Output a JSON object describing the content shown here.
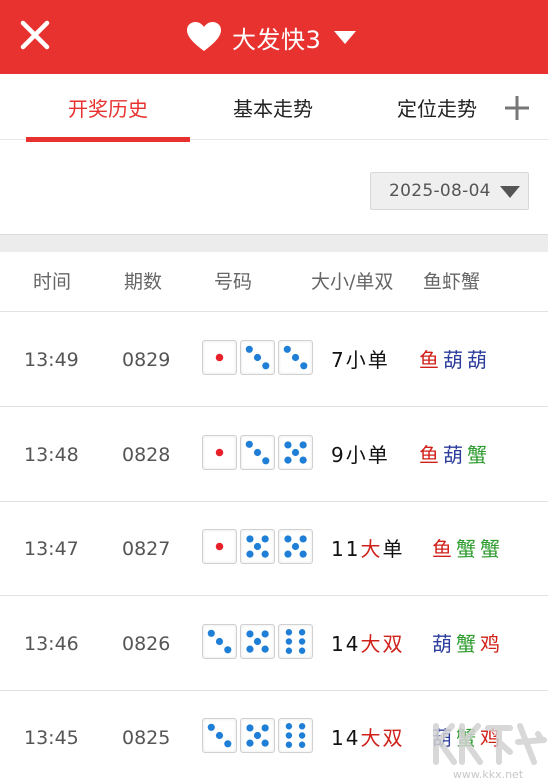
{
  "header": {
    "title": "大发快3",
    "close_icon": "close-icon",
    "favorite_icon": "heart-icon",
    "dropdown_icon": "caret-down-icon",
    "bar_color": "#e8322f"
  },
  "tabs": [
    {
      "label": "开奖历史",
      "active": true
    },
    {
      "label": "基本走势",
      "active": false
    },
    {
      "label": "定位走势",
      "active": false
    }
  ],
  "add_tab_icon": "plus-icon",
  "date_filter": {
    "value": "2025-08-04",
    "icon": "caret-down-icon"
  },
  "table": {
    "columns": [
      "时间",
      "期数",
      "号码",
      "大小/单双",
      "鱼虾蟹"
    ],
    "rows": [
      {
        "time": "13:49",
        "period": "0829",
        "dice": [
          1,
          3,
          3
        ],
        "sum": "7",
        "size": "小",
        "parity": "单",
        "animals": [
          "鱼",
          "葫",
          "葫"
        ]
      },
      {
        "time": "13:48",
        "period": "0828",
        "dice": [
          1,
          3,
          5
        ],
        "sum": "9",
        "size": "小",
        "parity": "单",
        "animals": [
          "鱼",
          "葫",
          "蟹"
        ]
      },
      {
        "time": "13:47",
        "period": "0827",
        "dice": [
          1,
          5,
          5
        ],
        "sum": "11",
        "size": "大",
        "parity": "单",
        "animals": [
          "鱼",
          "蟹",
          "蟹"
        ]
      },
      {
        "time": "13:46",
        "period": "0826",
        "dice": [
          3,
          5,
          6
        ],
        "sum": "14",
        "size": "大",
        "parity": "双",
        "animals": [
          "葫",
          "蟹",
          "鸡"
        ]
      },
      {
        "time": "13:45",
        "period": "0825",
        "dice": [
          3,
          5,
          6
        ],
        "sum": "14",
        "size": "大",
        "parity": "双",
        "animals": [
          "葫",
          "蟹",
          "鸡"
        ]
      }
    ]
  },
  "colors": {
    "accent": "#e8322f",
    "big": "#d0201a",
    "small": "#111111",
    "odd": "#111111",
    "even": "#d0201a",
    "fish": "#d0201a",
    "gourd": "#2b3c9c",
    "crab": "#2f9c2f",
    "chicken": "#d0201a",
    "pip_one": "#e8202a",
    "pip": "#1f7fd6"
  }
}
